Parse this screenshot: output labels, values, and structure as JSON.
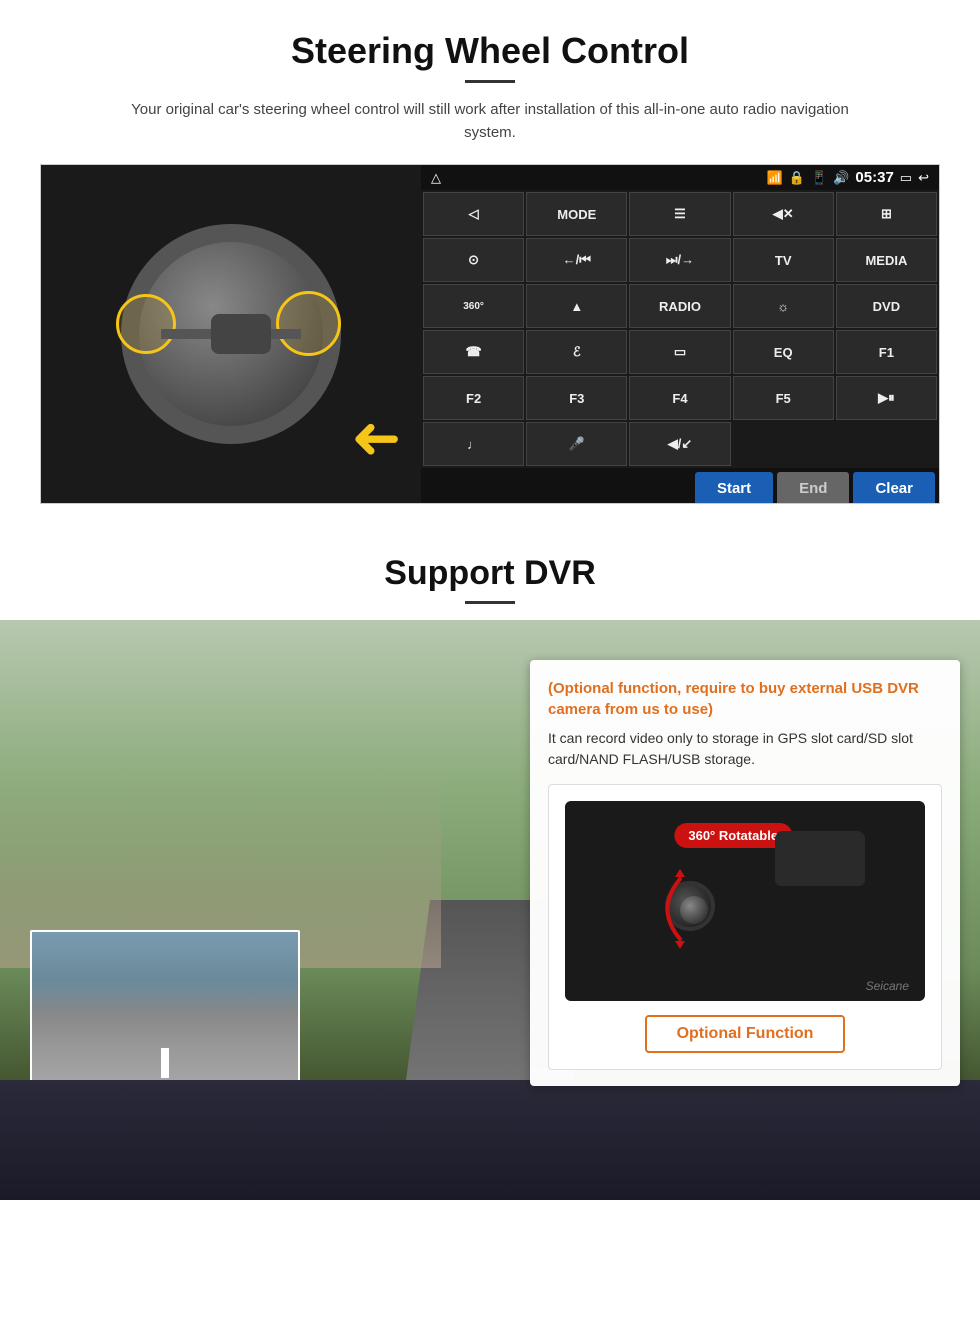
{
  "steering": {
    "title": "Steering Wheel Control",
    "subtitle": "Your original car's steering wheel control will still work after installation of this all-in-one auto radio navigation system.",
    "status_bar": {
      "time": "05:37",
      "wifi_icon": "wifi",
      "lock_icon": "lock",
      "signal_icon": "signal",
      "volume_icon": "volume",
      "window_icon": "window",
      "back_icon": "back"
    },
    "buttons": [
      {
        "label": "◁",
        "row": 1,
        "col": 1
      },
      {
        "label": "MODE",
        "row": 1,
        "col": 2
      },
      {
        "label": "≡",
        "row": 1,
        "col": 3
      },
      {
        "label": "◀✕",
        "row": 1,
        "col": 4
      },
      {
        "label": "⊞",
        "row": 1,
        "col": 5
      },
      {
        "label": "☉",
        "row": 2,
        "col": 1
      },
      {
        "label": "←/⏮",
        "row": 2,
        "col": 2
      },
      {
        "label": "⏭/→",
        "row": 2,
        "col": 3
      },
      {
        "label": "TV",
        "row": 2,
        "col": 4
      },
      {
        "label": "MEDIA",
        "row": 2,
        "col": 5
      },
      {
        "label": "360",
        "row": 3,
        "col": 1
      },
      {
        "label": "▲",
        "row": 3,
        "col": 2
      },
      {
        "label": "RADIO",
        "row": 3,
        "col": 3
      },
      {
        "label": "☼",
        "row": 3,
        "col": 4
      },
      {
        "label": "DVD",
        "row": 3,
        "col": 5
      },
      {
        "label": "☎",
        "row": 4,
        "col": 1
      },
      {
        "label": "ℰ",
        "row": 4,
        "col": 2
      },
      {
        "label": "▭",
        "row": 4,
        "col": 3
      },
      {
        "label": "EQ",
        "row": 4,
        "col": 4
      },
      {
        "label": "F1",
        "row": 4,
        "col": 5
      },
      {
        "label": "F2",
        "row": 5,
        "col": 1
      },
      {
        "label": "F3",
        "row": 5,
        "col": 2
      },
      {
        "label": "F4",
        "row": 5,
        "col": 3
      },
      {
        "label": "F5",
        "row": 5,
        "col": 4
      },
      {
        "label": "▶⏸",
        "row": 5,
        "col": 5
      },
      {
        "label": "♪",
        "row": 6,
        "col": 1
      },
      {
        "label": "🎤",
        "row": 6,
        "col": 2
      },
      {
        "label": "◀/↙",
        "row": 6,
        "col": 3
      }
    ],
    "actions": {
      "start": "Start",
      "end": "End",
      "clear": "Clear"
    }
  },
  "dvr": {
    "title": "Support DVR",
    "optional_text": "(Optional function, require to buy external USB DVR camera from us to use)",
    "desc_text": "It can record video only to storage in GPS slot card/SD slot card/NAND FLASH/USB storage.",
    "badge_360": "360° Rotatable",
    "watermark": "Seicane",
    "optional_func_label": "Optional Function"
  }
}
